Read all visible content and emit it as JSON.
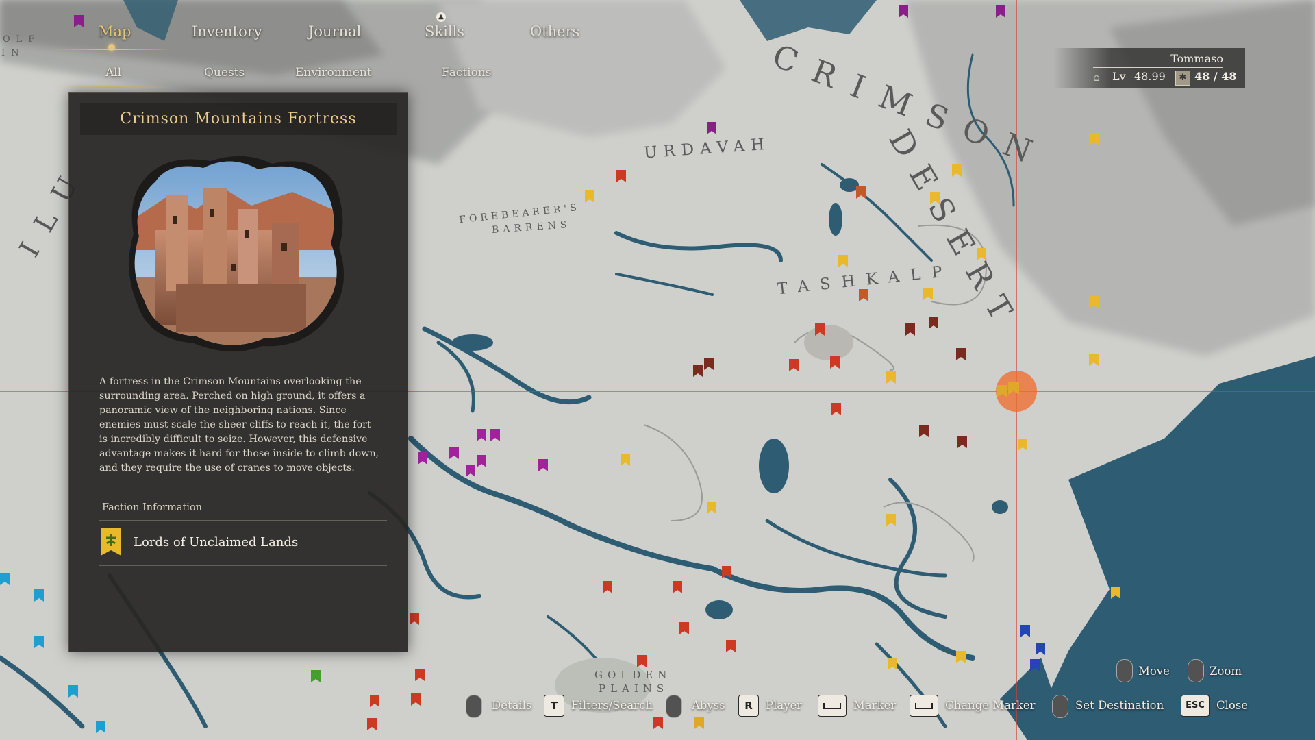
{
  "nav": {
    "tabs": [
      {
        "label": "Map",
        "active": true
      },
      {
        "label": "Inventory"
      },
      {
        "label": "Journal"
      },
      {
        "label": "Skills"
      },
      {
        "label": "Others"
      }
    ],
    "subtabs": [
      {
        "label": "All",
        "active": true
      },
      {
        "label": "Quests"
      },
      {
        "label": "Environment"
      },
      {
        "label": "Factions"
      }
    ]
  },
  "player": {
    "name": "Tommaso",
    "level_label": "Lv",
    "level": "48.99",
    "count": "48 / 48"
  },
  "panel": {
    "title": "Crimson Mountains Fortress",
    "description": "A fortress in the Crimson Mountains overlooking the surrounding area. Perched on high ground, it offers a panoramic view of the neighboring nations. Since enemies must scale the sheer cliffs to reach it, the fort is incredibly difficult to seize. However, this defensive advantage makes it hard for those inside to climb down, and they require the use of cranes to move objects.",
    "faction_header": "Faction Information",
    "faction_name": "Lords of Unclaimed Lands"
  },
  "map_labels": {
    "crimson": "CRIMSON",
    "desert": "DESERT",
    "urdavah": "URDAVAH",
    "tashkalp": "TASHKALP",
    "forebearers_1": "FOREBEARER'S",
    "forebearers_2": "BARRENS",
    "golden_1": "GOLDEN",
    "golden_2": "PLAINS",
    "left_1": "ILU",
    "left_2": "OLF",
    "left_3": "IN"
  },
  "hints": {
    "move": "Move",
    "zoom": "Zoom",
    "details": "Details",
    "filters_key": "T",
    "filters": "Filters/Search",
    "abyss": "Abyss",
    "player_key": "R",
    "player": "Player",
    "marker": "Marker",
    "change_marker": "Change Marker",
    "set_destination": "Set Destination",
    "close_key": "ESC",
    "close": "Close"
  },
  "colors": {
    "accent": "#e8c57a",
    "crosshair": "#d8402f",
    "cursor": "#f26a2a",
    "water": "#2e5c72",
    "land": "#cfd0cc"
  }
}
